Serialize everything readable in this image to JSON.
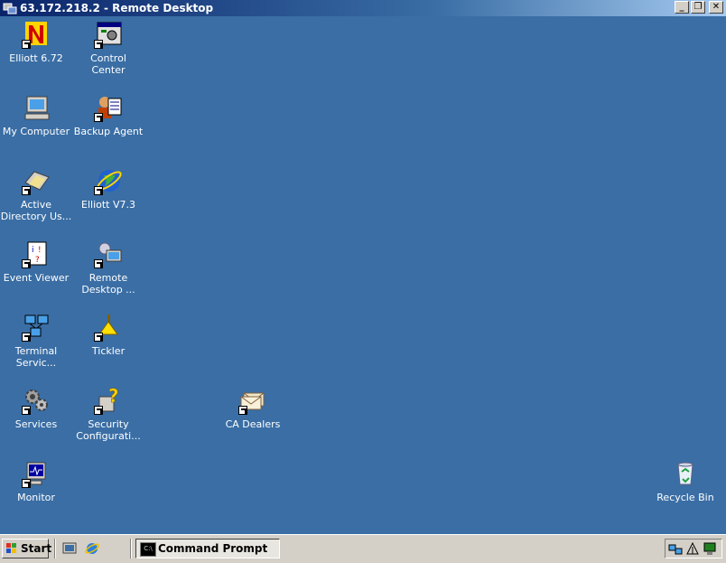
{
  "window": {
    "title": "63.172.218.2 - Remote Desktop",
    "minimize": "_",
    "restore": "❐",
    "close": "✕"
  },
  "icons": [
    {
      "id": "elliott-672",
      "label": "Elliott 6.72",
      "line2": ""
    },
    {
      "id": "control-center",
      "label": "Control Center",
      "line2": ""
    },
    {
      "id": "my-computer",
      "label": "My Computer",
      "line2": ""
    },
    {
      "id": "backup-agent",
      "label": "Backup Agent",
      "line2": ""
    },
    {
      "id": "active-directory",
      "label": "Active",
      "line2": "Directory Us..."
    },
    {
      "id": "elliott-v73",
      "label": "Elliott V7.3",
      "line2": ""
    },
    {
      "id": "event-viewer",
      "label": "Event Viewer",
      "line2": ""
    },
    {
      "id": "remote-desktop",
      "label": "Remote",
      "line2": "Desktop ..."
    },
    {
      "id": "terminal-services",
      "label": "Terminal",
      "line2": "Servic..."
    },
    {
      "id": "tickler",
      "label": "Tickler",
      "line2": ""
    },
    {
      "id": "services",
      "label": "Services",
      "line2": ""
    },
    {
      "id": "security-config",
      "label": "Security",
      "line2": "Configurati..."
    },
    {
      "id": "ca-dealers",
      "label": "CA Dealers",
      "line2": ""
    },
    {
      "id": "monitor",
      "label": "Monitor",
      "line2": ""
    },
    {
      "id": "recycle-bin",
      "label": "Recycle Bin",
      "line2": ""
    }
  ],
  "taskbar": {
    "start_label": "Start",
    "task_label": "Command Prompt",
    "task_icon_text": "C:\\"
  },
  "colors": {
    "desktop": "#3a6ea5",
    "titlebar": "#0a246a",
    "taskbar": "#d4d0c8"
  }
}
